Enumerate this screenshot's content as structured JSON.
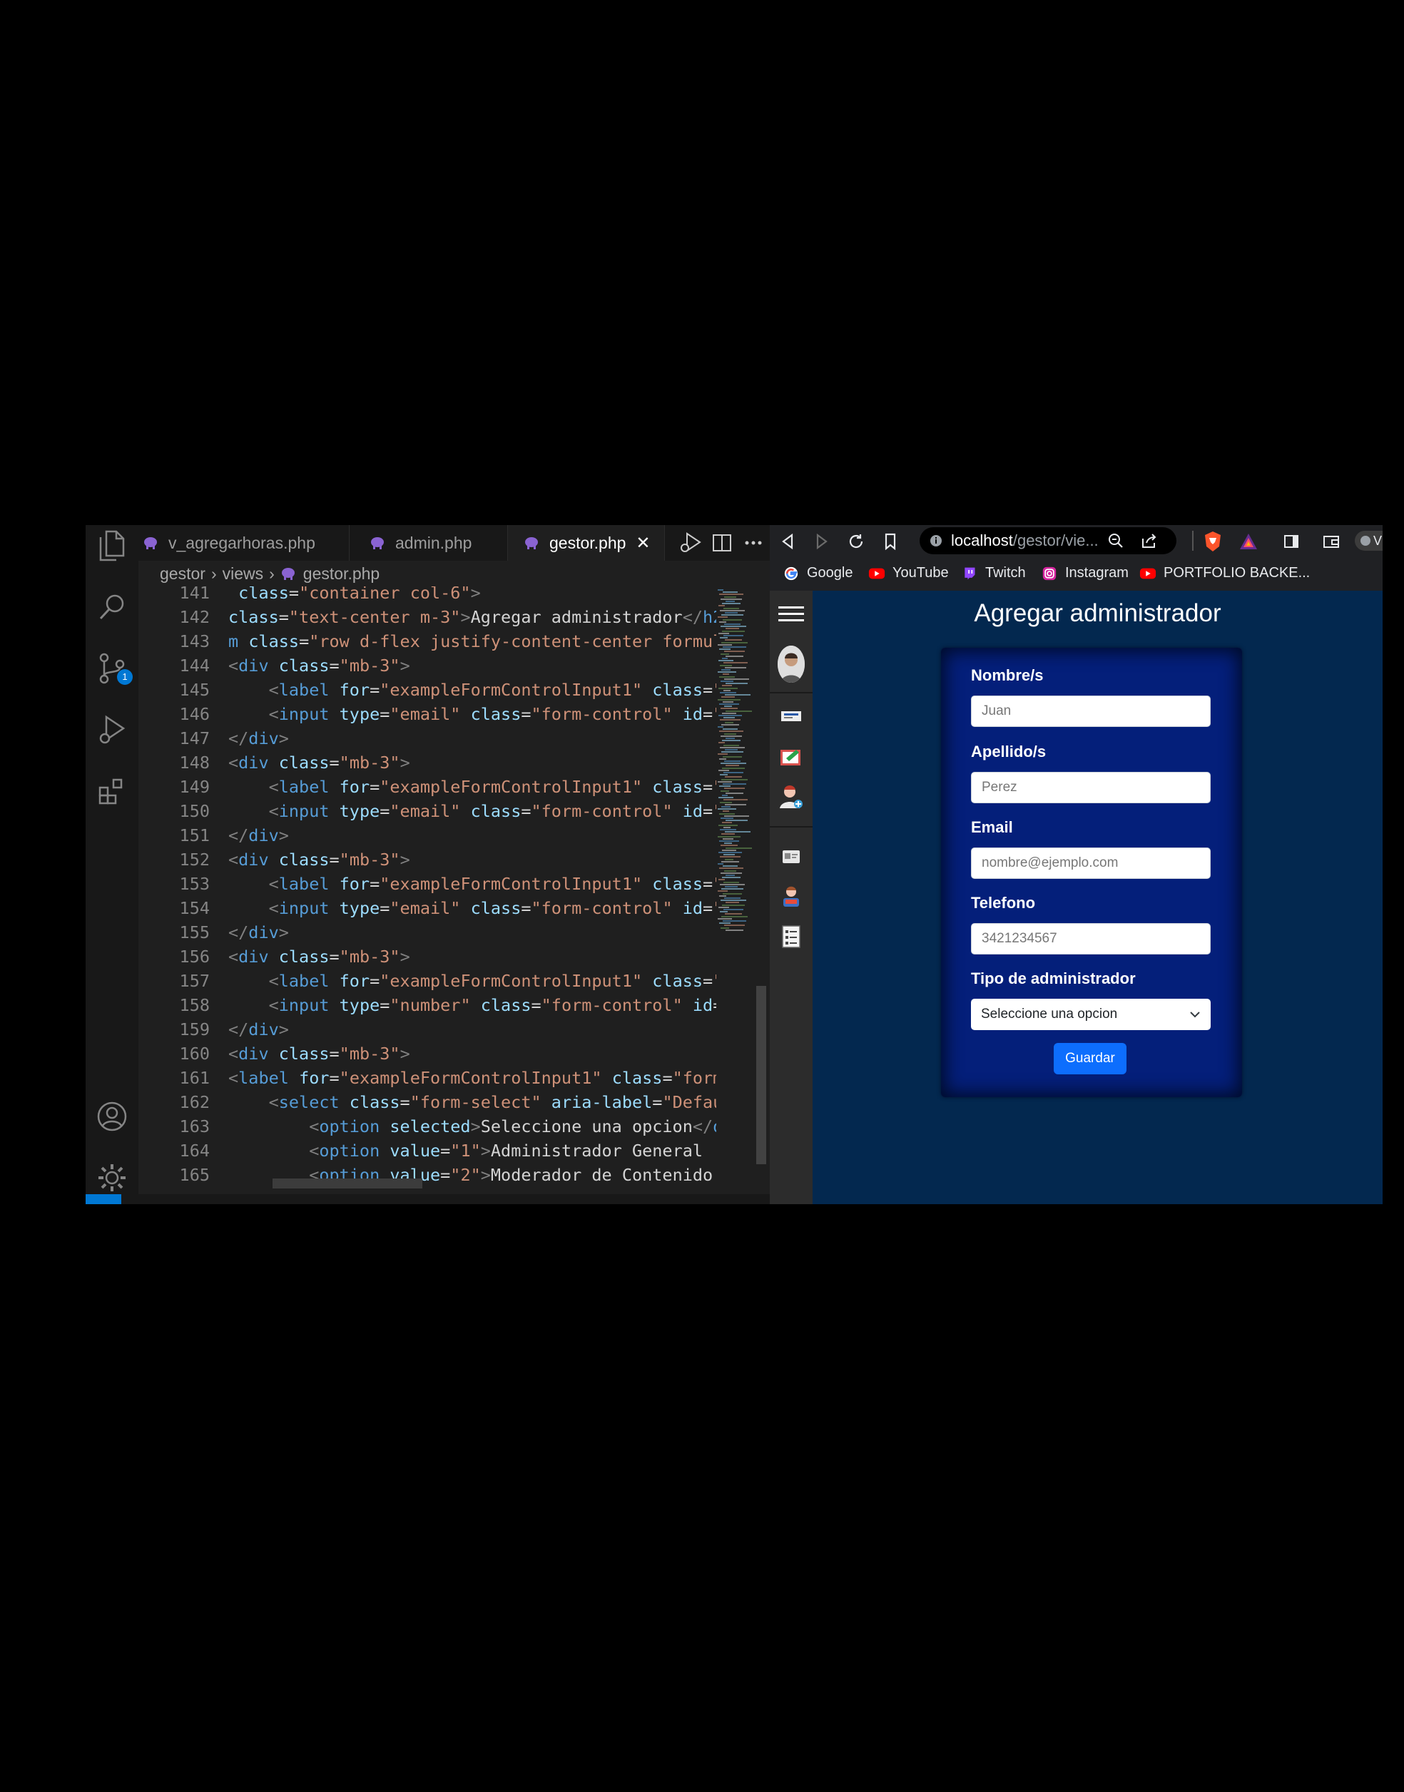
{
  "editor": {
    "tabs": [
      {
        "label": "v_agregarhoras.php",
        "active": false
      },
      {
        "label": "admin.php",
        "active": false
      },
      {
        "label": "gestor.php",
        "active": true
      }
    ],
    "breadcrumb": [
      "gestor",
      "views",
      "gestor.php"
    ],
    "source_control_badge": "1",
    "lines": [
      {
        "n": "141",
        "segs": [
          [
            "t-attr",
            "class"
          ],
          [
            "t-txt",
            "="
          ],
          [
            "t-str",
            "\"container col-6\""
          ],
          [
            "t-p",
            ">"
          ]
        ],
        "indent": " "
      },
      {
        "n": "142",
        "segs": [
          [
            "t-attr",
            "class"
          ],
          [
            "t-txt",
            "="
          ],
          [
            "t-str",
            "\"text-center m-3\""
          ],
          [
            "t-p",
            ">"
          ],
          [
            "t-txt",
            "Agregar administrador"
          ],
          [
            "t-p",
            "</"
          ],
          [
            "t-tag",
            "h2"
          ],
          [
            "t-p",
            ">"
          ]
        ],
        "indent": ""
      },
      {
        "n": "143",
        "segs": [
          [
            "t-tag",
            "m"
          ],
          [
            "t-txt",
            " "
          ],
          [
            "t-attr",
            "class"
          ],
          [
            "t-txt",
            "="
          ],
          [
            "t-str",
            "\"row d-flex justify-content-center formula"
          ]
        ],
        "indent": ""
      },
      {
        "n": "144",
        "segs": [
          [
            "t-p",
            "<"
          ],
          [
            "t-tag",
            "div"
          ],
          [
            "t-txt",
            " "
          ],
          [
            "t-attr",
            "class"
          ],
          [
            "t-txt",
            "="
          ],
          [
            "t-str",
            "\"mb-3\""
          ],
          [
            "t-p",
            ">"
          ]
        ],
        "indent": ""
      },
      {
        "n": "145",
        "segs": [
          [
            "t-p",
            "<"
          ],
          [
            "t-tag",
            "label"
          ],
          [
            "t-txt",
            " "
          ],
          [
            "t-attr",
            "for"
          ],
          [
            "t-txt",
            "="
          ],
          [
            "t-str",
            "\"exampleFormControlInput1\""
          ],
          [
            "t-txt",
            " "
          ],
          [
            "t-attr",
            "class"
          ],
          [
            "t-txt",
            "="
          ],
          [
            "t-str",
            "\"f"
          ]
        ],
        "indent": "    "
      },
      {
        "n": "146",
        "segs": [
          [
            "t-p",
            "<"
          ],
          [
            "t-tag",
            "input"
          ],
          [
            "t-txt",
            " "
          ],
          [
            "t-attr",
            "type"
          ],
          [
            "t-txt",
            "="
          ],
          [
            "t-str",
            "\"email\""
          ],
          [
            "t-txt",
            " "
          ],
          [
            "t-attr",
            "class"
          ],
          [
            "t-txt",
            "="
          ],
          [
            "t-str",
            "\"form-control\""
          ],
          [
            "t-txt",
            " "
          ],
          [
            "t-attr",
            "id"
          ],
          [
            "t-txt",
            "="
          ],
          [
            "t-str",
            "\"e"
          ]
        ],
        "indent": "    "
      },
      {
        "n": "147",
        "segs": [
          [
            "t-p",
            "</"
          ],
          [
            "t-tag",
            "div"
          ],
          [
            "t-p",
            ">"
          ]
        ],
        "indent": ""
      },
      {
        "n": "148",
        "segs": [
          [
            "t-p",
            "<"
          ],
          [
            "t-tag",
            "div"
          ],
          [
            "t-txt",
            " "
          ],
          [
            "t-attr",
            "class"
          ],
          [
            "t-txt",
            "="
          ],
          [
            "t-str",
            "\"mb-3\""
          ],
          [
            "t-p",
            ">"
          ]
        ],
        "indent": ""
      },
      {
        "n": "149",
        "segs": [
          [
            "t-p",
            "<"
          ],
          [
            "t-tag",
            "label"
          ],
          [
            "t-txt",
            " "
          ],
          [
            "t-attr",
            "for"
          ],
          [
            "t-txt",
            "="
          ],
          [
            "t-str",
            "\"exampleFormControlInput1\""
          ],
          [
            "t-txt",
            " "
          ],
          [
            "t-attr",
            "class"
          ],
          [
            "t-txt",
            "="
          ],
          [
            "t-str",
            "\"f"
          ]
        ],
        "indent": "    "
      },
      {
        "n": "150",
        "segs": [
          [
            "t-p",
            "<"
          ],
          [
            "t-tag",
            "input"
          ],
          [
            "t-txt",
            " "
          ],
          [
            "t-attr",
            "type"
          ],
          [
            "t-txt",
            "="
          ],
          [
            "t-str",
            "\"email\""
          ],
          [
            "t-txt",
            " "
          ],
          [
            "t-attr",
            "class"
          ],
          [
            "t-txt",
            "="
          ],
          [
            "t-str",
            "\"form-control\""
          ],
          [
            "t-txt",
            " "
          ],
          [
            "t-attr",
            "id"
          ],
          [
            "t-txt",
            "="
          ],
          [
            "t-str",
            "\"e"
          ]
        ],
        "indent": "    "
      },
      {
        "n": "151",
        "segs": [
          [
            "t-p",
            "</"
          ],
          [
            "t-tag",
            "div"
          ],
          [
            "t-p",
            ">"
          ]
        ],
        "indent": ""
      },
      {
        "n": "152",
        "segs": [
          [
            "t-p",
            "<"
          ],
          [
            "t-tag",
            "div"
          ],
          [
            "t-txt",
            " "
          ],
          [
            "t-attr",
            "class"
          ],
          [
            "t-txt",
            "="
          ],
          [
            "t-str",
            "\"mb-3\""
          ],
          [
            "t-p",
            ">"
          ]
        ],
        "indent": ""
      },
      {
        "n": "153",
        "segs": [
          [
            "t-p",
            "<"
          ],
          [
            "t-tag",
            "label"
          ],
          [
            "t-txt",
            " "
          ],
          [
            "t-attr",
            "for"
          ],
          [
            "t-txt",
            "="
          ],
          [
            "t-str",
            "\"exampleFormControlInput1\""
          ],
          [
            "t-txt",
            " "
          ],
          [
            "t-attr",
            "class"
          ],
          [
            "t-txt",
            "="
          ],
          [
            "t-str",
            "\"f"
          ]
        ],
        "indent": "    "
      },
      {
        "n": "154",
        "segs": [
          [
            "t-p",
            "<"
          ],
          [
            "t-tag",
            "input"
          ],
          [
            "t-txt",
            " "
          ],
          [
            "t-attr",
            "type"
          ],
          [
            "t-txt",
            "="
          ],
          [
            "t-str",
            "\"email\""
          ],
          [
            "t-txt",
            " "
          ],
          [
            "t-attr",
            "class"
          ],
          [
            "t-txt",
            "="
          ],
          [
            "t-str",
            "\"form-control\""
          ],
          [
            "t-txt",
            " "
          ],
          [
            "t-attr",
            "id"
          ],
          [
            "t-txt",
            "="
          ],
          [
            "t-str",
            "\"e"
          ]
        ],
        "indent": "    "
      },
      {
        "n": "155",
        "segs": [
          [
            "t-p",
            "</"
          ],
          [
            "t-tag",
            "div"
          ],
          [
            "t-p",
            ">"
          ]
        ],
        "indent": ""
      },
      {
        "n": "156",
        "segs": [
          [
            "t-p",
            "<"
          ],
          [
            "t-tag",
            "div"
          ],
          [
            "t-txt",
            " "
          ],
          [
            "t-attr",
            "class"
          ],
          [
            "t-txt",
            "="
          ],
          [
            "t-str",
            "\"mb-3\""
          ],
          [
            "t-p",
            ">"
          ]
        ],
        "indent": ""
      },
      {
        "n": "157",
        "segs": [
          [
            "t-p",
            "<"
          ],
          [
            "t-tag",
            "label"
          ],
          [
            "t-txt",
            " "
          ],
          [
            "t-attr",
            "for"
          ],
          [
            "t-txt",
            "="
          ],
          [
            "t-str",
            "\"exampleFormControlInput1\""
          ],
          [
            "t-txt",
            " "
          ],
          [
            "t-attr",
            "class"
          ],
          [
            "t-txt",
            "="
          ],
          [
            "t-str",
            "\"f"
          ]
        ],
        "indent": "    "
      },
      {
        "n": "158",
        "segs": [
          [
            "t-p",
            "<"
          ],
          [
            "t-tag",
            "input"
          ],
          [
            "t-txt",
            " "
          ],
          [
            "t-attr",
            "type"
          ],
          [
            "t-txt",
            "="
          ],
          [
            "t-str",
            "\"number\""
          ],
          [
            "t-txt",
            " "
          ],
          [
            "t-attr",
            "class"
          ],
          [
            "t-txt",
            "="
          ],
          [
            "t-str",
            "\"form-control\""
          ],
          [
            "t-txt",
            " "
          ],
          [
            "t-attr",
            "id"
          ],
          [
            "t-txt",
            "="
          ],
          [
            "t-str",
            "\""
          ]
        ],
        "indent": "    "
      },
      {
        "n": "159",
        "segs": [
          [
            "t-p",
            "</"
          ],
          [
            "t-tag",
            "div"
          ],
          [
            "t-p",
            ">"
          ]
        ],
        "indent": ""
      },
      {
        "n": "160",
        "segs": [
          [
            "t-p",
            "<"
          ],
          [
            "t-tag",
            "div"
          ],
          [
            "t-txt",
            " "
          ],
          [
            "t-attr",
            "class"
          ],
          [
            "t-txt",
            "="
          ],
          [
            "t-str",
            "\"mb-3\""
          ],
          [
            "t-p",
            ">"
          ]
        ],
        "indent": ""
      },
      {
        "n": "161",
        "segs": [
          [
            "t-p",
            "<"
          ],
          [
            "t-tag",
            "label"
          ],
          [
            "t-txt",
            " "
          ],
          [
            "t-attr",
            "for"
          ],
          [
            "t-txt",
            "="
          ],
          [
            "t-str",
            "\"exampleFormControlInput1\""
          ],
          [
            "t-txt",
            " "
          ],
          [
            "t-attr",
            "class"
          ],
          [
            "t-txt",
            "="
          ],
          [
            "t-str",
            "\"form-"
          ]
        ],
        "indent": ""
      },
      {
        "n": "162",
        "segs": [
          [
            "t-p",
            "<"
          ],
          [
            "t-tag",
            "select"
          ],
          [
            "t-txt",
            " "
          ],
          [
            "t-attr",
            "class"
          ],
          [
            "t-txt",
            "="
          ],
          [
            "t-str",
            "\"form-select\""
          ],
          [
            "t-txt",
            " "
          ],
          [
            "t-attr",
            "aria-label"
          ],
          [
            "t-txt",
            "="
          ],
          [
            "t-str",
            "\"Defaul"
          ]
        ],
        "indent": "    "
      },
      {
        "n": "163",
        "segs": [
          [
            "t-p",
            "<"
          ],
          [
            "t-tag",
            "option"
          ],
          [
            "t-txt",
            " "
          ],
          [
            "t-attr",
            "selected"
          ],
          [
            "t-p",
            ">"
          ],
          [
            "t-txt",
            "Seleccione una opcion"
          ],
          [
            "t-p",
            "</"
          ],
          [
            "t-tag",
            "op"
          ]
        ],
        "indent": "        "
      },
      {
        "n": "164",
        "segs": [
          [
            "t-p",
            "<"
          ],
          [
            "t-tag",
            "option"
          ],
          [
            "t-txt",
            " "
          ],
          [
            "t-attr",
            "value"
          ],
          [
            "t-txt",
            "="
          ],
          [
            "t-str",
            "\"1\""
          ],
          [
            "t-p",
            ">"
          ],
          [
            "t-txt",
            "Administrador General (t"
          ]
        ],
        "indent": "        "
      },
      {
        "n": "165",
        "segs": [
          [
            "t-p",
            "<"
          ],
          [
            "t-tag",
            "option"
          ],
          [
            "t-txt",
            " "
          ],
          [
            "t-attr",
            "value"
          ],
          [
            "t-txt",
            "="
          ],
          [
            "t-str",
            "\"2\""
          ],
          [
            "t-p",
            ">"
          ],
          [
            "t-txt",
            "Moderador de Contenido ("
          ]
        ],
        "indent": "        "
      }
    ]
  },
  "browser": {
    "url_host": "localhost",
    "url_path": "/gestor/vie...",
    "bookmarks": [
      "Google",
      "YouTube",
      "Twitch",
      "Instagram",
      "PORTFOLIO BACKE..."
    ],
    "tab_fragment": "V",
    "page": {
      "title": "Agregar administrador",
      "fields": [
        {
          "label": "Nombre/s",
          "placeholder": "Juan"
        },
        {
          "label": "Apellido/s",
          "placeholder": "Perez"
        },
        {
          "label": "Email",
          "placeholder": "nombre@ejemplo.com"
        },
        {
          "label": "Telefono",
          "placeholder": "3421234567"
        }
      ],
      "select_label": "Tipo de administrador",
      "select_value": "Seleccione una opcion",
      "submit_label": "Guardar"
    }
  },
  "colors": {
    "editor_bg": "#1f1f1f",
    "page_bg": "#03284f",
    "form_bg": "#041f7a",
    "button_bg": "#0d6efd",
    "accent": "#0078d4"
  }
}
